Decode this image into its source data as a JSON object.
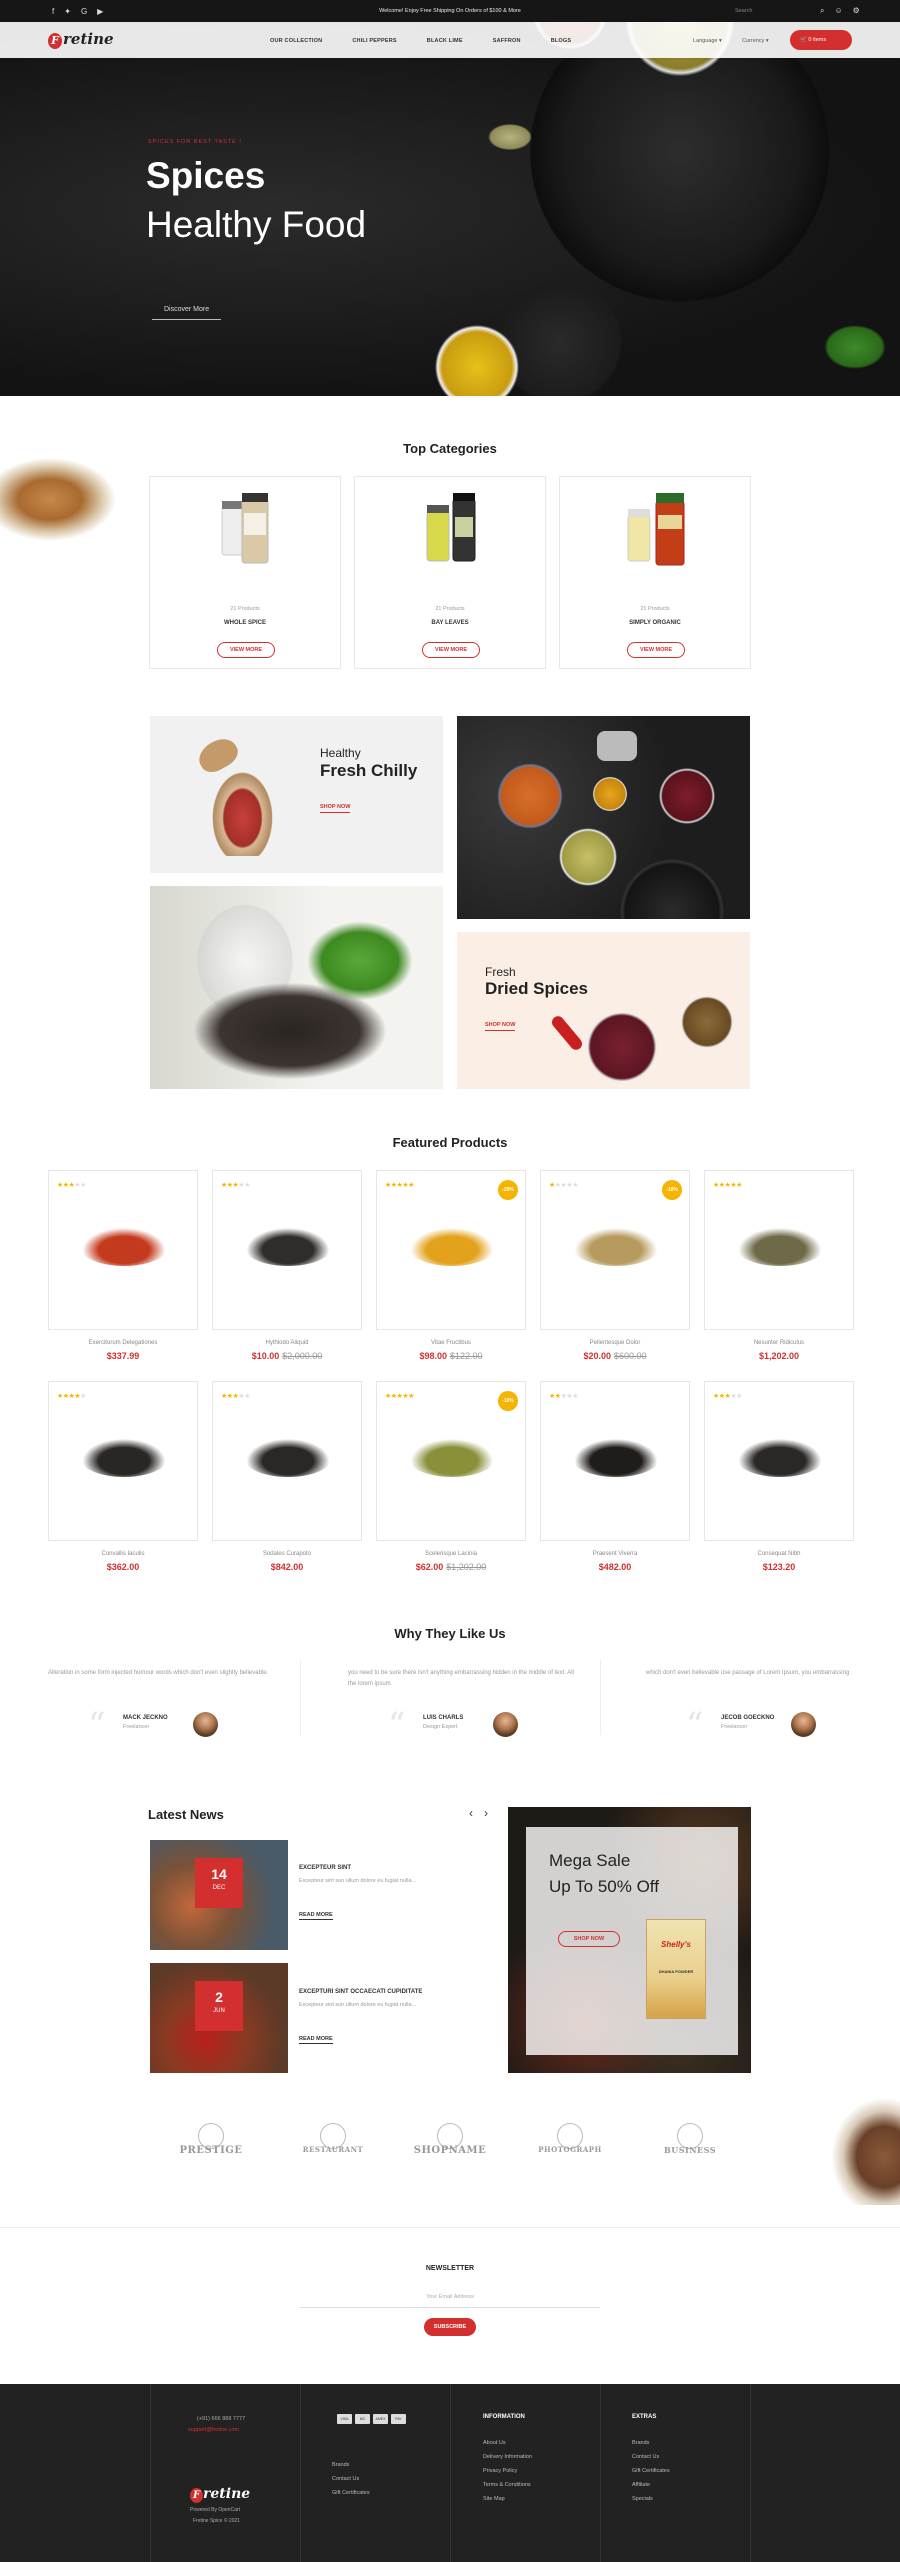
{
  "colors": {
    "accent": "#d32f2f",
    "star": "#f4b400",
    "footer_bg": "#222222"
  },
  "topbar": {
    "social_icons": [
      "facebook-icon",
      "twitter-icon",
      "google-plus-icon",
      "youtube-icon"
    ],
    "welcome": "Welcome! Enjoy Free Shipping On Orders of $100 & More",
    "search_placeholder": "Search"
  },
  "nav": {
    "logo": "retine",
    "logo_initial": "F",
    "menu": [
      "OUR COLLECTION",
      "CHILI PEPPERS",
      "BLACK LIME",
      "SAFFRON",
      "BLOGS"
    ],
    "language": "Language ▾",
    "currency": "Currency ▾",
    "cart": "0 items"
  },
  "hero": {
    "tagline": "SPICES FOR BEST TASTE !",
    "title_line1": "Spices",
    "title_line2": "Healthy Food",
    "button": "Discover More"
  },
  "categories": {
    "title": "Top Categories",
    "items": [
      {
        "count": "21 Products",
        "name": "WHOLE SPICE",
        "button": "VIEW MORE"
      },
      {
        "count": "21 Products",
        "name": "BAY LEAVES",
        "button": "VIEW MORE"
      },
      {
        "count": "21 Products",
        "name": "SIMPLY ORGANIC",
        "button": "VIEW MORE"
      }
    ]
  },
  "banners": {
    "chilly": {
      "small": "Healthy",
      "big": "Fresh Chilly",
      "link": "SHOP NOW"
    },
    "dried": {
      "small": "Fresh",
      "big": "Dried Spices",
      "link": "SHOP NOW"
    }
  },
  "featured": {
    "title": "Featured Products",
    "products": [
      {
        "name": "Exercitorum Delegationes",
        "price": "$337.99",
        "old": "",
        "rating": 3,
        "badge": ""
      },
      {
        "name": "Hythlodo Aliquid",
        "price": "$10.00",
        "old": "$2,000.00",
        "rating": 3,
        "badge": ""
      },
      {
        "name": "Vitae Fructibus",
        "price": "$98.00",
        "old": "$122.00",
        "rating": 5,
        "badge": "-20%"
      },
      {
        "name": "Pellentesque Dolor",
        "price": "$20.00",
        "old": "$600.00",
        "rating": 1,
        "badge": "-10%"
      },
      {
        "name": "Nesunter Ridiculus",
        "price": "$1,202.00",
        "old": "",
        "rating": 5,
        "badge": ""
      },
      {
        "name": "Convallis Iaculis",
        "price": "$362.00",
        "old": "",
        "rating": 4,
        "badge": ""
      },
      {
        "name": "Sodales Curapoto",
        "price": "$842.00",
        "old": "",
        "rating": 3,
        "badge": ""
      },
      {
        "name": "Scelerisque Lacinia",
        "price": "$62.00",
        "old": "$1,202.00",
        "rating": 5,
        "badge": "-10%"
      },
      {
        "name": "Praesent Viverra",
        "price": "$482.00",
        "old": "",
        "rating": 2,
        "badge": ""
      },
      {
        "name": "Consequat Nibh",
        "price": "$123.20",
        "old": "",
        "rating": 3,
        "badge": ""
      }
    ]
  },
  "testimonials": {
    "title": "Why They Like Us",
    "items": [
      {
        "text": "Alteration in some form injected humour words which don't even slightly believable.",
        "name": "MACK JECKNO",
        "role": "Freelancer"
      },
      {
        "text": "you need to be sure there isn't anything embarrassing hidden in the middle of text. All the lorem ipsum",
        "name": "LUIS CHARLS",
        "role": "Design Expert"
      },
      {
        "text": "which don't even believable use passage of Lorem Ipsum, you embarrassing",
        "name": "JECOB GOECKNO",
        "role": "Freelancer"
      }
    ]
  },
  "news": {
    "title": "Latest News",
    "prev": "‹",
    "next": "›",
    "items": [
      {
        "day": "14",
        "month": "DEC",
        "title": "EXCEPTEUR SINT",
        "text": "Excepteur sint sun ullum dolore eu fugiat nulla...",
        "link": "READ MORE"
      },
      {
        "day": "2",
        "month": "JUN",
        "title": "EXCEPTURI SINT OCCAECATI CUPIDITATE",
        "text": "Excepteur sint sun ullum dolore eu fugiat nulla...",
        "link": "READ MORE"
      }
    ]
  },
  "mega": {
    "line1": "Mega Sale",
    "line2": "Up To 50% Off",
    "button": "SHOP NOW",
    "pack_brand": "Shelly's",
    "pack_label": "DHANIA POWDER"
  },
  "brands": [
    "PRESTIGE",
    "RESTAURANT",
    "SHOPNAME",
    "PHOTOGRAPH",
    "BUSINESS"
  ],
  "newsletter": {
    "title": "NEWSLETTER",
    "placeholder": "Your Email Address",
    "button": "SUBSCRIBE"
  },
  "footer": {
    "phone": "(+91) 666 888 7777",
    "email": "support@fretine.com",
    "links1": [
      "Brands",
      "Contact Us",
      "Gift Certificates"
    ],
    "powered": "Powered By OpenCart",
    "copy": "Fretine Spice © 2021",
    "pay": [
      "VISA",
      "MC",
      "AMEX",
      "PAY"
    ],
    "info_title": "INFORMATION",
    "info": [
      "About Us",
      "Delivery Information",
      "Privacy Policy",
      "Terms & Conditions",
      "Site Map"
    ],
    "extras_title": "EXTRAS",
    "extras": [
      "Brands",
      "Contact Us",
      "Gift Certificates",
      "Affiliate",
      "Specials"
    ]
  }
}
